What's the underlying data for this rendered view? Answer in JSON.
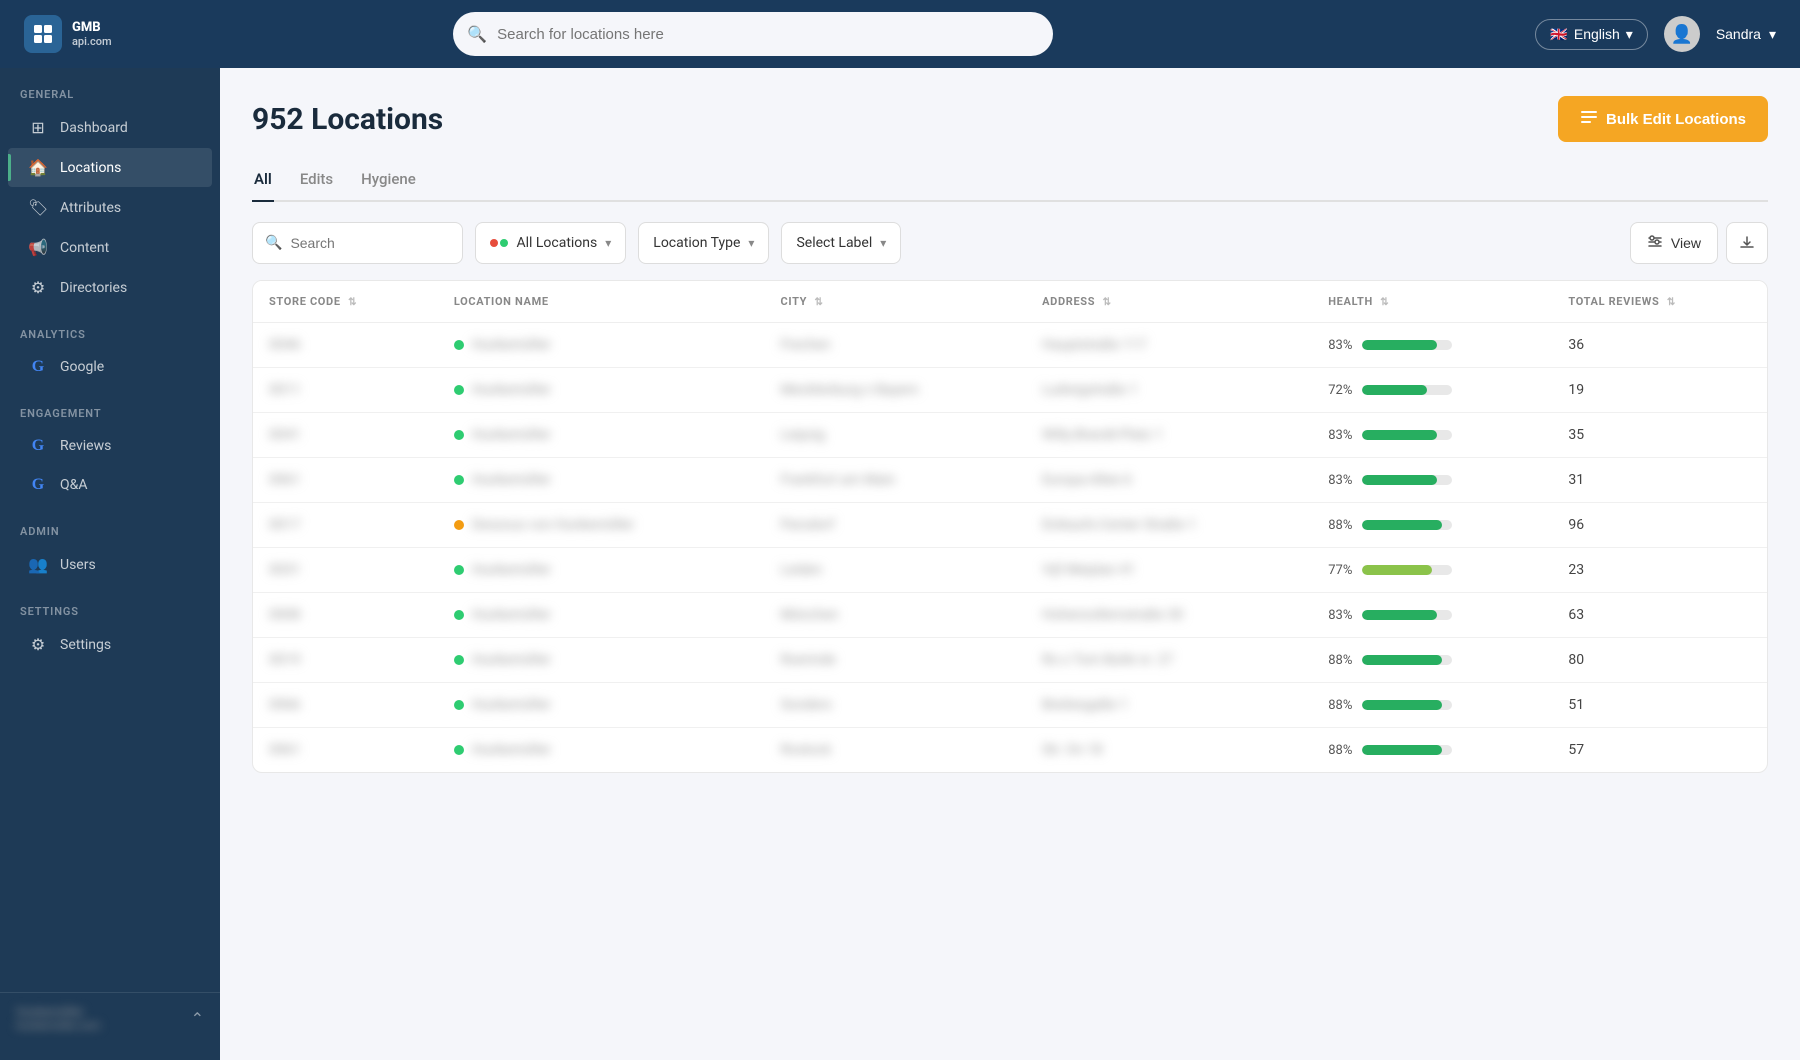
{
  "topnav": {
    "logo_text": "GMB\napi.com",
    "search_placeholder": "Search for locations here",
    "language": "English",
    "user_name": "Sandra"
  },
  "sidebar": {
    "sections": [
      {
        "label": "GENERAL",
        "items": [
          {
            "id": "dashboard",
            "label": "Dashboard",
            "icon": "⊞",
            "active": false
          },
          {
            "id": "locations",
            "label": "Locations",
            "icon": "🏠",
            "active": true
          },
          {
            "id": "attributes",
            "label": "Attributes",
            "icon": "🏷",
            "active": false
          },
          {
            "id": "content",
            "label": "Content",
            "icon": "📢",
            "active": false
          },
          {
            "id": "directories",
            "label": "Directories",
            "icon": "⚙",
            "active": false
          }
        ]
      },
      {
        "label": "ANALYTICS",
        "items": [
          {
            "id": "google",
            "label": "Google",
            "icon": "G",
            "active": false
          }
        ]
      },
      {
        "label": "ENGAGEMENT",
        "items": [
          {
            "id": "reviews",
            "label": "Reviews",
            "icon": "G",
            "active": false
          },
          {
            "id": "qanda",
            "label": "Q&A",
            "icon": "G",
            "active": false
          }
        ]
      },
      {
        "label": "ADMIN",
        "items": [
          {
            "id": "users",
            "label": "Users",
            "icon": "👥",
            "active": false
          }
        ]
      },
      {
        "label": "SETTINGS",
        "items": [
          {
            "id": "settings",
            "label": "Settings",
            "icon": "⚙",
            "active": false
          }
        ]
      }
    ],
    "bottom_user": "Hunkemöller",
    "bottom_sub": "hunkemoller.com"
  },
  "page": {
    "title": "952 Locations",
    "bulk_edit_label": "Bulk Edit Locations"
  },
  "tabs": [
    {
      "id": "all",
      "label": "All",
      "active": true
    },
    {
      "id": "edits",
      "label": "Edits",
      "active": false
    },
    {
      "id": "hygiene",
      "label": "Hygiene",
      "active": false
    }
  ],
  "filters": {
    "search_placeholder": "Search",
    "location_filter": "All Locations",
    "location_type": "Location Type",
    "select_label": "Select Label",
    "view_label": "View"
  },
  "table": {
    "columns": [
      {
        "id": "store_code",
        "label": "STORE CODE"
      },
      {
        "id": "location_name",
        "label": "LOCATION NAME"
      },
      {
        "id": "city",
        "label": "CITY"
      },
      {
        "id": "address",
        "label": "ADDRESS"
      },
      {
        "id": "health",
        "label": "HEALTH"
      },
      {
        "id": "total_reviews",
        "label": "TOTAL REVIEWS"
      }
    ],
    "rows": [
      {
        "store_code": "0046",
        "location_name": "Hunkemöller",
        "dot": "green",
        "city": "Frechen",
        "address": "Hauptstraße 117",
        "health_pct": 83,
        "health_color": "#27ae60",
        "total_reviews": 36
      },
      {
        "store_code": "0011",
        "location_name": "Hunkemöller",
        "dot": "green",
        "city": "Mecklenburg n Bayern",
        "address": "Ludwigstraße 1",
        "health_pct": 72,
        "health_color": "#27ae60",
        "total_reviews": 19
      },
      {
        "store_code": "0041",
        "location_name": "Hunkemöller",
        "dot": "green",
        "city": "Leipzig",
        "address": "Willy-Brandt-Platz 1",
        "health_pct": 83,
        "health_color": "#27ae60",
        "total_reviews": 35
      },
      {
        "store_code": "0061",
        "location_name": "Hunkemöller",
        "dot": "green",
        "city": "Frankfurt am Main",
        "address": "Europa-Allee 6",
        "health_pct": 83,
        "health_color": "#27ae60",
        "total_reviews": 31
      },
      {
        "store_code": "0017",
        "location_name": "Dessous von Hunkemöller",
        "dot": "orange",
        "city": "Parsdorf",
        "address": "Einkaufs-Center Straße 1",
        "health_pct": 88,
        "health_color": "#27ae60",
        "total_reviews": 96
      },
      {
        "store_code": "0031",
        "location_name": "Hunkemöller",
        "dot": "green",
        "city": "Leiden",
        "address": "Vijf Meiplan 41",
        "health_pct": 77,
        "health_color": "#8bc34a",
        "total_reviews": 23
      },
      {
        "store_code": "0008",
        "location_name": "Hunkemöller",
        "dot": "green",
        "city": "München",
        "address": "Hohenzollernstraße 30",
        "health_pct": 83,
        "health_color": "#27ae60",
        "total_reviews": 63
      },
      {
        "store_code": "0019",
        "location_name": "Hunkemöller",
        "dot": "green",
        "city": "Roerinde",
        "address": "Ro s Tom Buhk nr. 27",
        "health_pct": 88,
        "health_color": "#27ae60",
        "total_reviews": 80
      },
      {
        "store_code": "0066",
        "location_name": "Hunkemöller",
        "dot": "green",
        "city": "Sonders",
        "address": "Breitesgaße 1",
        "health_pct": 88,
        "health_color": "#27ae60",
        "total_reviews": 51
      },
      {
        "store_code": "0061",
        "location_name": "Hunkemöller",
        "dot": "green",
        "city": "Rostock",
        "address": "Str. On 18",
        "health_pct": 88,
        "health_color": "#27ae60",
        "total_reviews": 57
      }
    ]
  }
}
